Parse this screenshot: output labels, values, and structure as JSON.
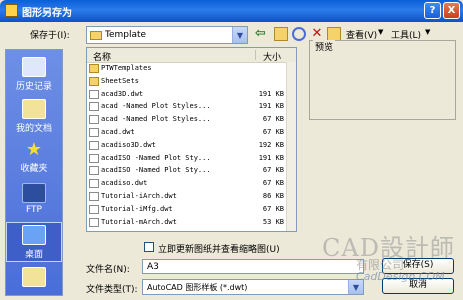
{
  "window": {
    "title": "图形另存为",
    "help": "?",
    "close": "X"
  },
  "save_in": {
    "label": "保存于(I):",
    "value": "Template"
  },
  "toolbar": {
    "view_label": "查看(V)",
    "tools_label": "工具(L)"
  },
  "places": [
    {
      "label": "历史记录",
      "icon": "history-icon"
    },
    {
      "label": "我的文档",
      "icon": "my-documents-icon"
    },
    {
      "label": "收藏夹",
      "icon": "favorites-icon"
    },
    {
      "label": "FTP",
      "icon": "ftp-icon"
    },
    {
      "label": "桌面",
      "icon": "desktop-icon"
    }
  ],
  "list": {
    "col_name": "名称",
    "col_size": "大小",
    "files": [
      {
        "name": "PTWTemplates",
        "size": "",
        "type": "folder"
      },
      {
        "name": "SheetSets",
        "size": "",
        "type": "folder"
      },
      {
        "name": "acad3D.dwt",
        "size": "191 KB",
        "type": "file"
      },
      {
        "name": "acad -Named Plot Styles...",
        "size": "191 KB",
        "type": "file"
      },
      {
        "name": "acad -Named Plot Styles...",
        "size": "67 KB",
        "type": "file"
      },
      {
        "name": "acad.dwt",
        "size": "67 KB",
        "type": "file"
      },
      {
        "name": "acadiso3D.dwt",
        "size": "192 KB",
        "type": "file"
      },
      {
        "name": "acadISO -Named Plot Sty...",
        "size": "191 KB",
        "type": "file"
      },
      {
        "name": "acadISO -Named Plot Sty...",
        "size": "67 KB",
        "type": "file"
      },
      {
        "name": "acadiso.dwt",
        "size": "67 KB",
        "type": "file"
      },
      {
        "name": "Tutorial-iArch.dwt",
        "size": "86 KB",
        "type": "file"
      },
      {
        "name": "Tutorial-iMfg.dwt",
        "size": "67 KB",
        "type": "file"
      },
      {
        "name": "Tutorial-mArch.dwt",
        "size": "53 KB",
        "type": "file"
      }
    ]
  },
  "preview": {
    "label": "预览"
  },
  "thumbnail_checkbox": {
    "label": "立即更新图纸并查看缩略图(U)"
  },
  "filename": {
    "label": "文件名(N):",
    "value": "A3"
  },
  "filetype": {
    "label": "文件类型(T):",
    "value": "AutoCAD 图形样板 (*.dwt)"
  },
  "buttons": {
    "save": "保存(S)",
    "cancel": "取消"
  },
  "watermark": {
    "main": "CAD設計師",
    "sub": "有限公司",
    "url": "CadDesign.COM"
  }
}
